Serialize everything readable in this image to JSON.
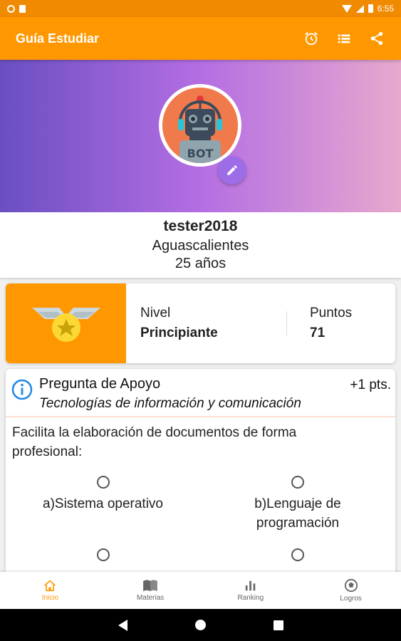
{
  "status_bar": {
    "time": "6:55"
  },
  "app_bar": {
    "title": "Guía Estudiar",
    "actions": [
      "alarm-icon",
      "list-icon",
      "share-icon"
    ]
  },
  "profile": {
    "username": "tester2018",
    "city": "Aguascalientes",
    "age": "25 años",
    "avatar_text": "BOT"
  },
  "level_card": {
    "nivel_label": "Nivel",
    "nivel_value": "Principiante",
    "puntos_label": "Puntos",
    "puntos_value": "71"
  },
  "question": {
    "title": "Pregunta de Apoyo",
    "points": "+1 pts.",
    "subject": "Tecnologías de información y comunicación",
    "text": "Facilita la elaboración de documentos de forma profesional:",
    "options": [
      {
        "label": "a)Sistema operativo"
      },
      {
        "label": "b)Lenguaje de programación"
      },
      {
        "label": ""
      },
      {
        "label": ""
      }
    ]
  },
  "bottom_nav": {
    "items": [
      {
        "label": "Inicio",
        "icon": "home-icon",
        "active": true
      },
      {
        "label": "Materias",
        "icon": "book-icon",
        "active": false
      },
      {
        "label": "Ranking",
        "icon": "bar-chart-icon",
        "active": false
      },
      {
        "label": "Logros",
        "icon": "soccer-ball-icon",
        "active": false
      }
    ]
  },
  "colors": {
    "primary": "#ff9800",
    "status_bar": "#f08a00",
    "accent_purple": "#9c6de6",
    "info_blue": "#1e88e5"
  }
}
